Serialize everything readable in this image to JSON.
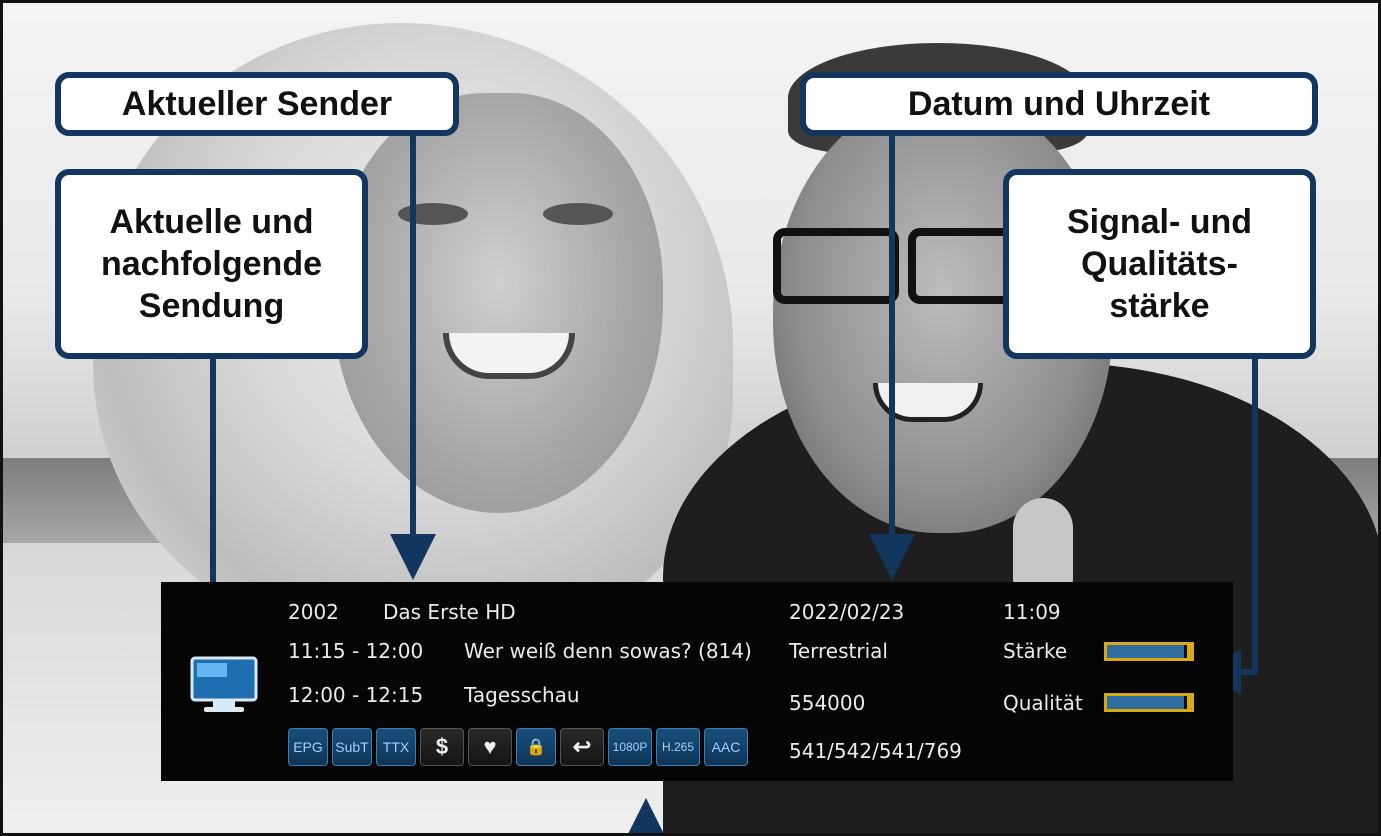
{
  "callouts": {
    "aktueller_sender": "Aktueller Sender",
    "datum_uhrzeit": "Datum und Uhrzeit",
    "sendung": [
      "Aktuelle und",
      "nachfolgende",
      "Sendung"
    ],
    "signal": [
      "Signal- und",
      "Qualitäts-",
      "stärke"
    ]
  },
  "infobar": {
    "channel_number": "2002",
    "channel_name": "Das Erste HD",
    "date": "2022/02/23",
    "time": "11:09",
    "current_time_range": "11:15 - 12:00",
    "current_program": "Wer weiß denn sowas? (814)",
    "next_time_range": "12:00 - 12:15",
    "next_program": "Tagesschau",
    "source": "Terrestrial",
    "frequency": "554000",
    "pids": "541/542/541/769",
    "strength_label": "Stärke",
    "quality_label": "Qualität",
    "strength_level": 0.92,
    "quality_level": 0.92,
    "buttons": [
      "EPG",
      "SubT",
      "TTX",
      "$",
      "♥",
      "🔒",
      "↩",
      "1080P",
      "H.265",
      "AAC"
    ]
  },
  "colors": {
    "callout_border": "#13365f",
    "bar_border": "#d9a817",
    "bar_fill": "#2f6d9e",
    "button_text": "#9fd1ff"
  }
}
